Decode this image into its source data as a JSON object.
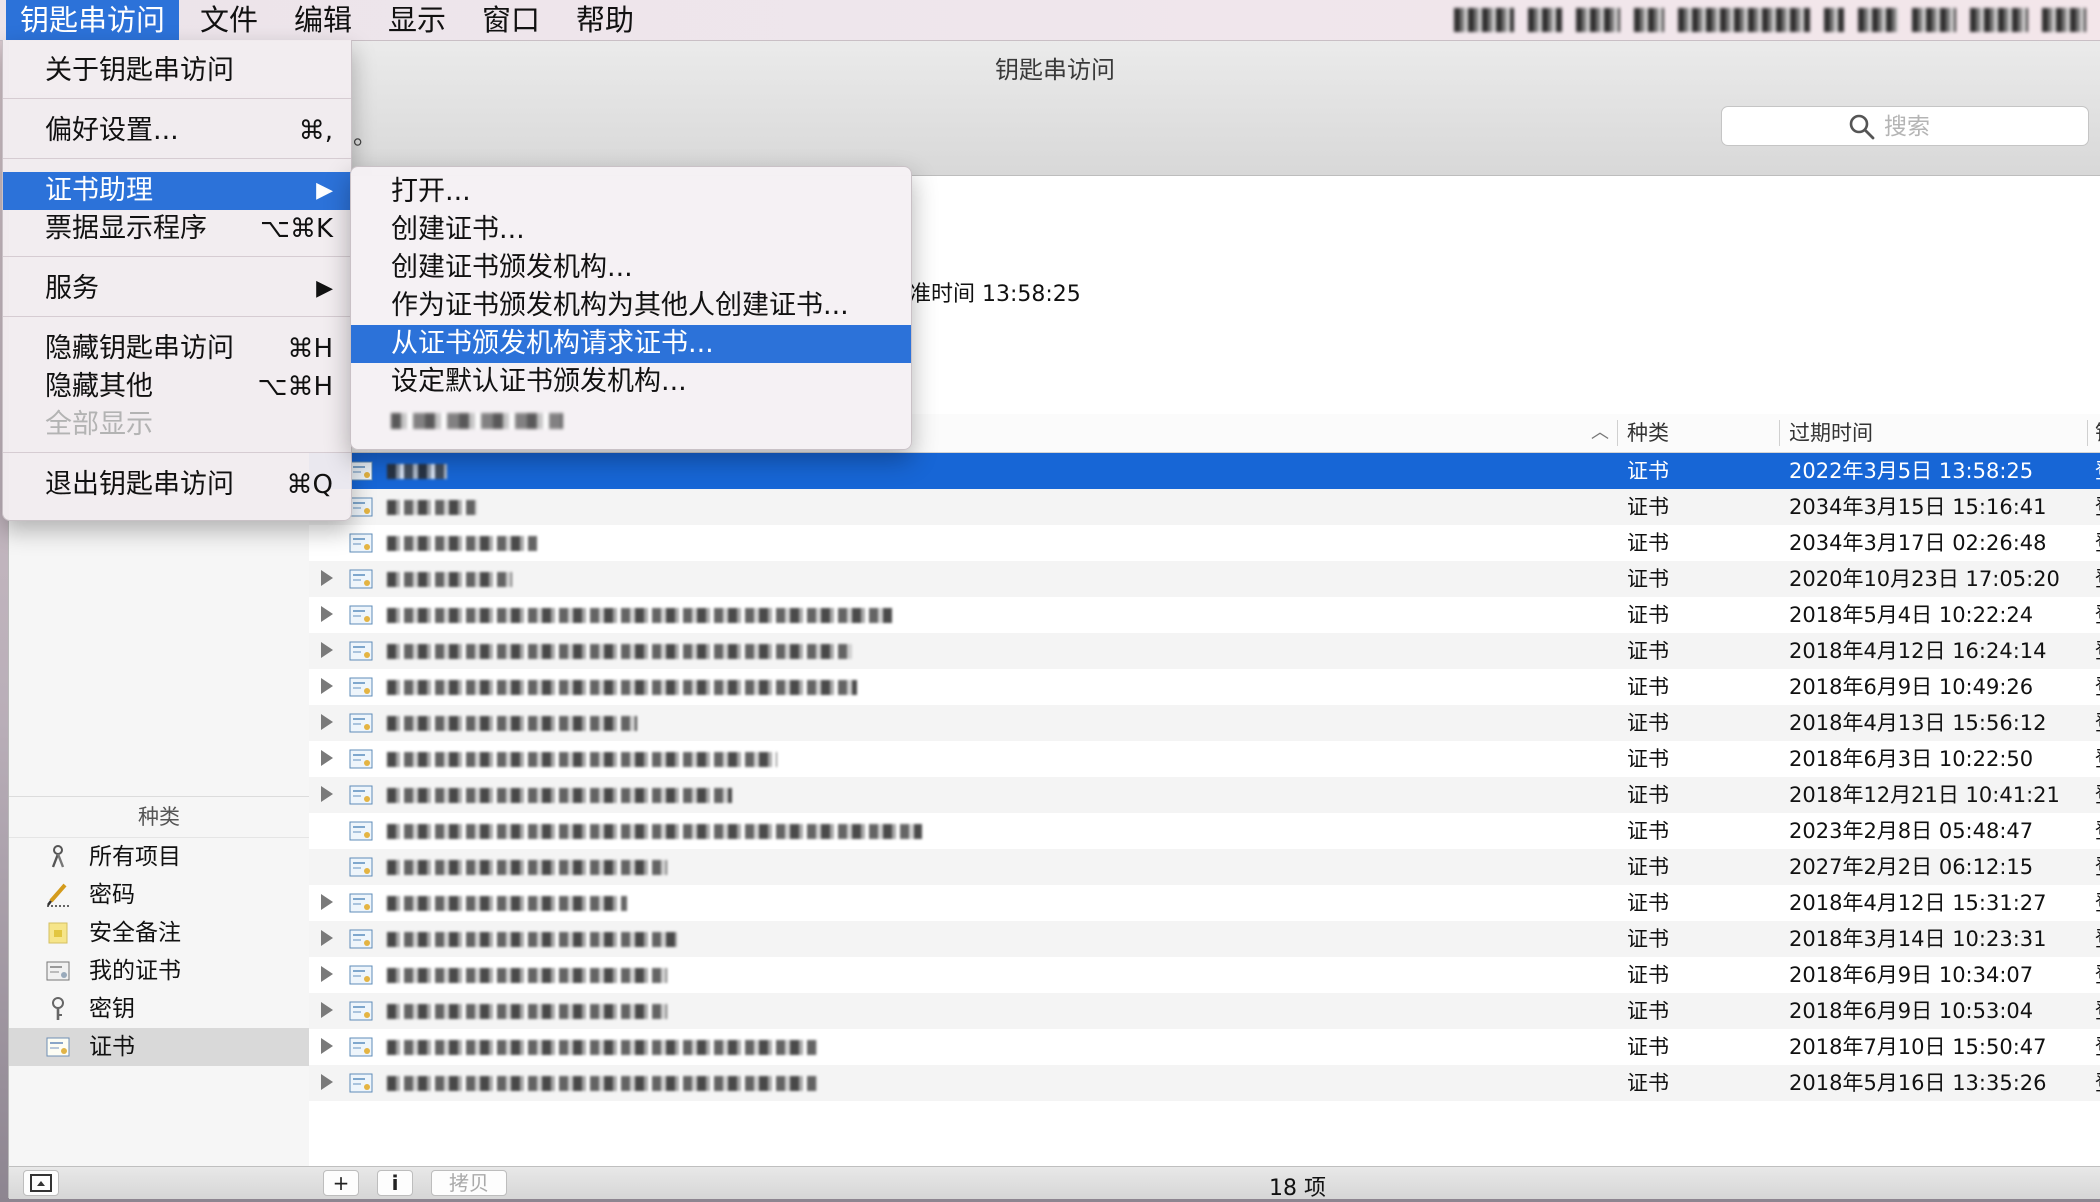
{
  "menubar": {
    "app_name": "钥匙串访问",
    "items": [
      "文件",
      "编辑",
      "显示",
      "窗口",
      "帮助"
    ]
  },
  "app_menu": {
    "items": [
      {
        "label": "关于钥匙串访问",
        "shortcut": ""
      },
      {
        "label": "偏好设置...",
        "shortcut": "⌘,"
      },
      {
        "label": "证书助理",
        "shortcut": "▶"
      },
      {
        "label": "票据显示程序",
        "shortcut": "⌥⌘K"
      },
      {
        "label": "服务",
        "shortcut": "▶"
      },
      {
        "label": "隐藏钥匙串访问",
        "shortcut": "⌘H"
      },
      {
        "label": "隐藏其他",
        "shortcut": "⌥⌘H"
      },
      {
        "label": "全部显示",
        "shortcut": ""
      },
      {
        "label": "退出钥匙串访问",
        "shortcut": "⌘Q"
      }
    ]
  },
  "cert_submenu": {
    "items": [
      "打开...",
      "创建证书...",
      "创建证书颁发机构...",
      "作为证书颁发机构为其他人创建证书...",
      "从证书颁发机构请求证书...",
      "设定默认证书颁发机构..."
    ]
  },
  "window": {
    "title": "钥匙串访问",
    "toolbar_fragment": "。",
    "search_placeholder": "搜索",
    "info_fragment": "准时间 13:58:25"
  },
  "sidebar": {
    "category_header": "种类",
    "categories": [
      {
        "label": "所有项目",
        "icon": "keys-icon"
      },
      {
        "label": "密码",
        "icon": "pen-icon"
      },
      {
        "label": "安全备注",
        "icon": "note-icon"
      },
      {
        "label": "我的证书",
        "icon": "my-cert-icon"
      },
      {
        "label": "密钥",
        "icon": "key-icon"
      },
      {
        "label": "证书",
        "icon": "cert-icon"
      }
    ],
    "selected": 5
  },
  "table": {
    "columns": {
      "kind": "种类",
      "expires": "过期时间",
      "keychain": "钥"
    },
    "rows": [
      {
        "kind": "证书",
        "expires": "2022年3月5日 13:58:25",
        "keychain": "登"
      },
      {
        "kind": "证书",
        "expires": "2034年3月15日 15:16:41",
        "keychain": "登"
      },
      {
        "kind": "证书",
        "expires": "2034年3月17日 02:26:48",
        "keychain": "登"
      },
      {
        "kind": "证书",
        "expires": "2020年10月23日 17:05:20",
        "keychain": "登"
      },
      {
        "kind": "证书",
        "expires": "2018年5月4日 10:22:24",
        "keychain": "登"
      },
      {
        "kind": "证书",
        "expires": "2018年4月12日 16:24:14",
        "keychain": "登"
      },
      {
        "kind": "证书",
        "expires": "2018年6月9日 10:49:26",
        "keychain": "登"
      },
      {
        "kind": "证书",
        "expires": "2018年4月13日 15:56:12",
        "keychain": "登"
      },
      {
        "kind": "证书",
        "expires": "2018年6月3日 10:22:50",
        "keychain": "登"
      },
      {
        "kind": "证书",
        "expires": "2018年12月21日 10:41:21",
        "keychain": "登"
      },
      {
        "kind": "证书",
        "expires": "2023年2月8日 05:48:47",
        "keychain": "登"
      },
      {
        "kind": "证书",
        "expires": "2027年2月2日 06:12:15",
        "keychain": "登"
      },
      {
        "kind": "证书",
        "expires": "2018年4月12日 15:31:27",
        "keychain": "登"
      },
      {
        "kind": "证书",
        "expires": "2018年3月14日 10:23:31",
        "keychain": "登"
      },
      {
        "kind": "证书",
        "expires": "2018年6月9日 10:34:07",
        "keychain": "登"
      },
      {
        "kind": "证书",
        "expires": "2018年6月9日 10:53:04",
        "keychain": "登"
      },
      {
        "kind": "证书",
        "expires": "2018年7月10日 15:50:47",
        "keychain": "登"
      },
      {
        "kind": "证书",
        "expires": "2018年5月16日 13:35:26",
        "keychain": "登"
      }
    ]
  },
  "bottombar": {
    "add_label": "+",
    "info_label": "i",
    "copy_label": "拷贝",
    "count": "18 项"
  },
  "colors": {
    "accent": "#2c72d9",
    "selection": "#1766d6"
  }
}
